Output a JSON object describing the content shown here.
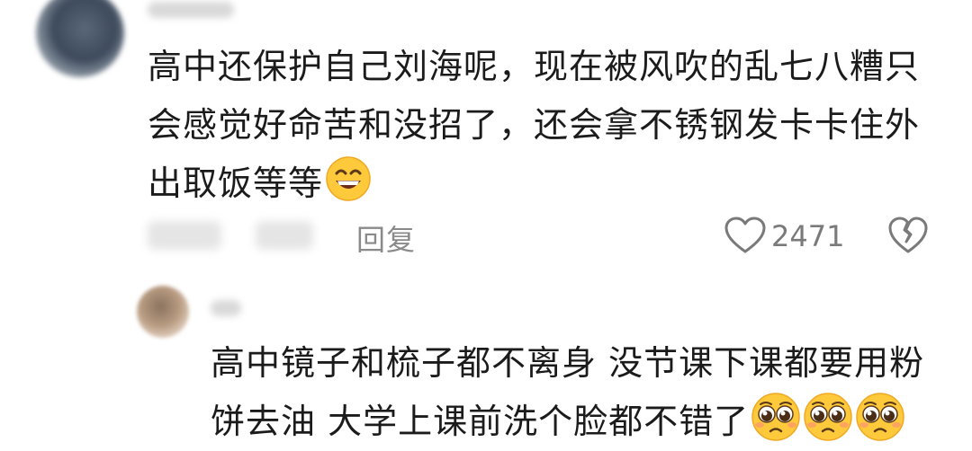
{
  "comment": {
    "text_line1": "高中还保护自己刘海呢，现在被风吹的乱七八糟只",
    "text_line2": "会感觉好命苦和没招了，还会拿不锈钢发卡卡住外",
    "text_line3": "出取饭等等",
    "reply_label": "回复",
    "like_count": "2471"
  },
  "reply": {
    "text_line1": "高中镜子和梳子都不离身 没节课下课都要用粉",
    "text_line2": "饼去油 大学上课前洗个脸都不错了"
  },
  "icons": {
    "grin_emoji": "grinning-face-emoji",
    "plead_emoji": "pleading-face-emoji",
    "like": "heart-outline-icon",
    "dislike": "broken-heart-icon"
  },
  "colors": {
    "meta_text": "#8a8a8a",
    "emoji_yellow": "#ffc93c"
  }
}
